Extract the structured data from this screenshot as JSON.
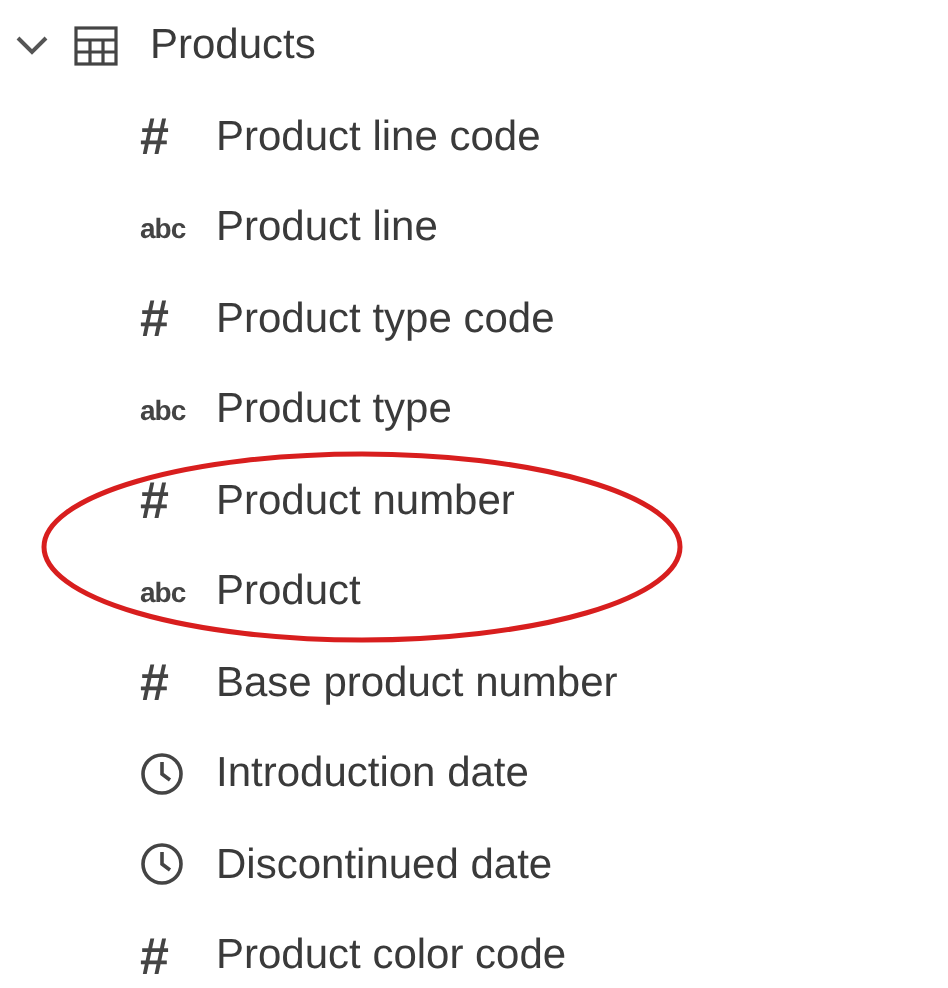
{
  "tree": {
    "label": "Products",
    "expanded": true,
    "children": [
      {
        "kind": "number",
        "glyph": "#",
        "label": "Product line code",
        "circled": false
      },
      {
        "kind": "text",
        "glyph": "abc",
        "label": "Product line",
        "circled": false
      },
      {
        "kind": "number",
        "glyph": "#",
        "label": "Product type code",
        "circled": false
      },
      {
        "kind": "text",
        "glyph": "abc",
        "label": "Product type",
        "circled": false
      },
      {
        "kind": "number",
        "glyph": "#",
        "label": "Product number",
        "circled": true
      },
      {
        "kind": "text",
        "glyph": "abc",
        "label": "Product",
        "circled": true
      },
      {
        "kind": "number",
        "glyph": "#",
        "label": "Base product number",
        "circled": false
      },
      {
        "kind": "date",
        "label": "Introduction date",
        "circled": false
      },
      {
        "kind": "date",
        "label": "Discontinued date",
        "circled": false
      },
      {
        "kind": "number",
        "glyph": "#",
        "label": "Product color code",
        "circled": false
      }
    ]
  }
}
